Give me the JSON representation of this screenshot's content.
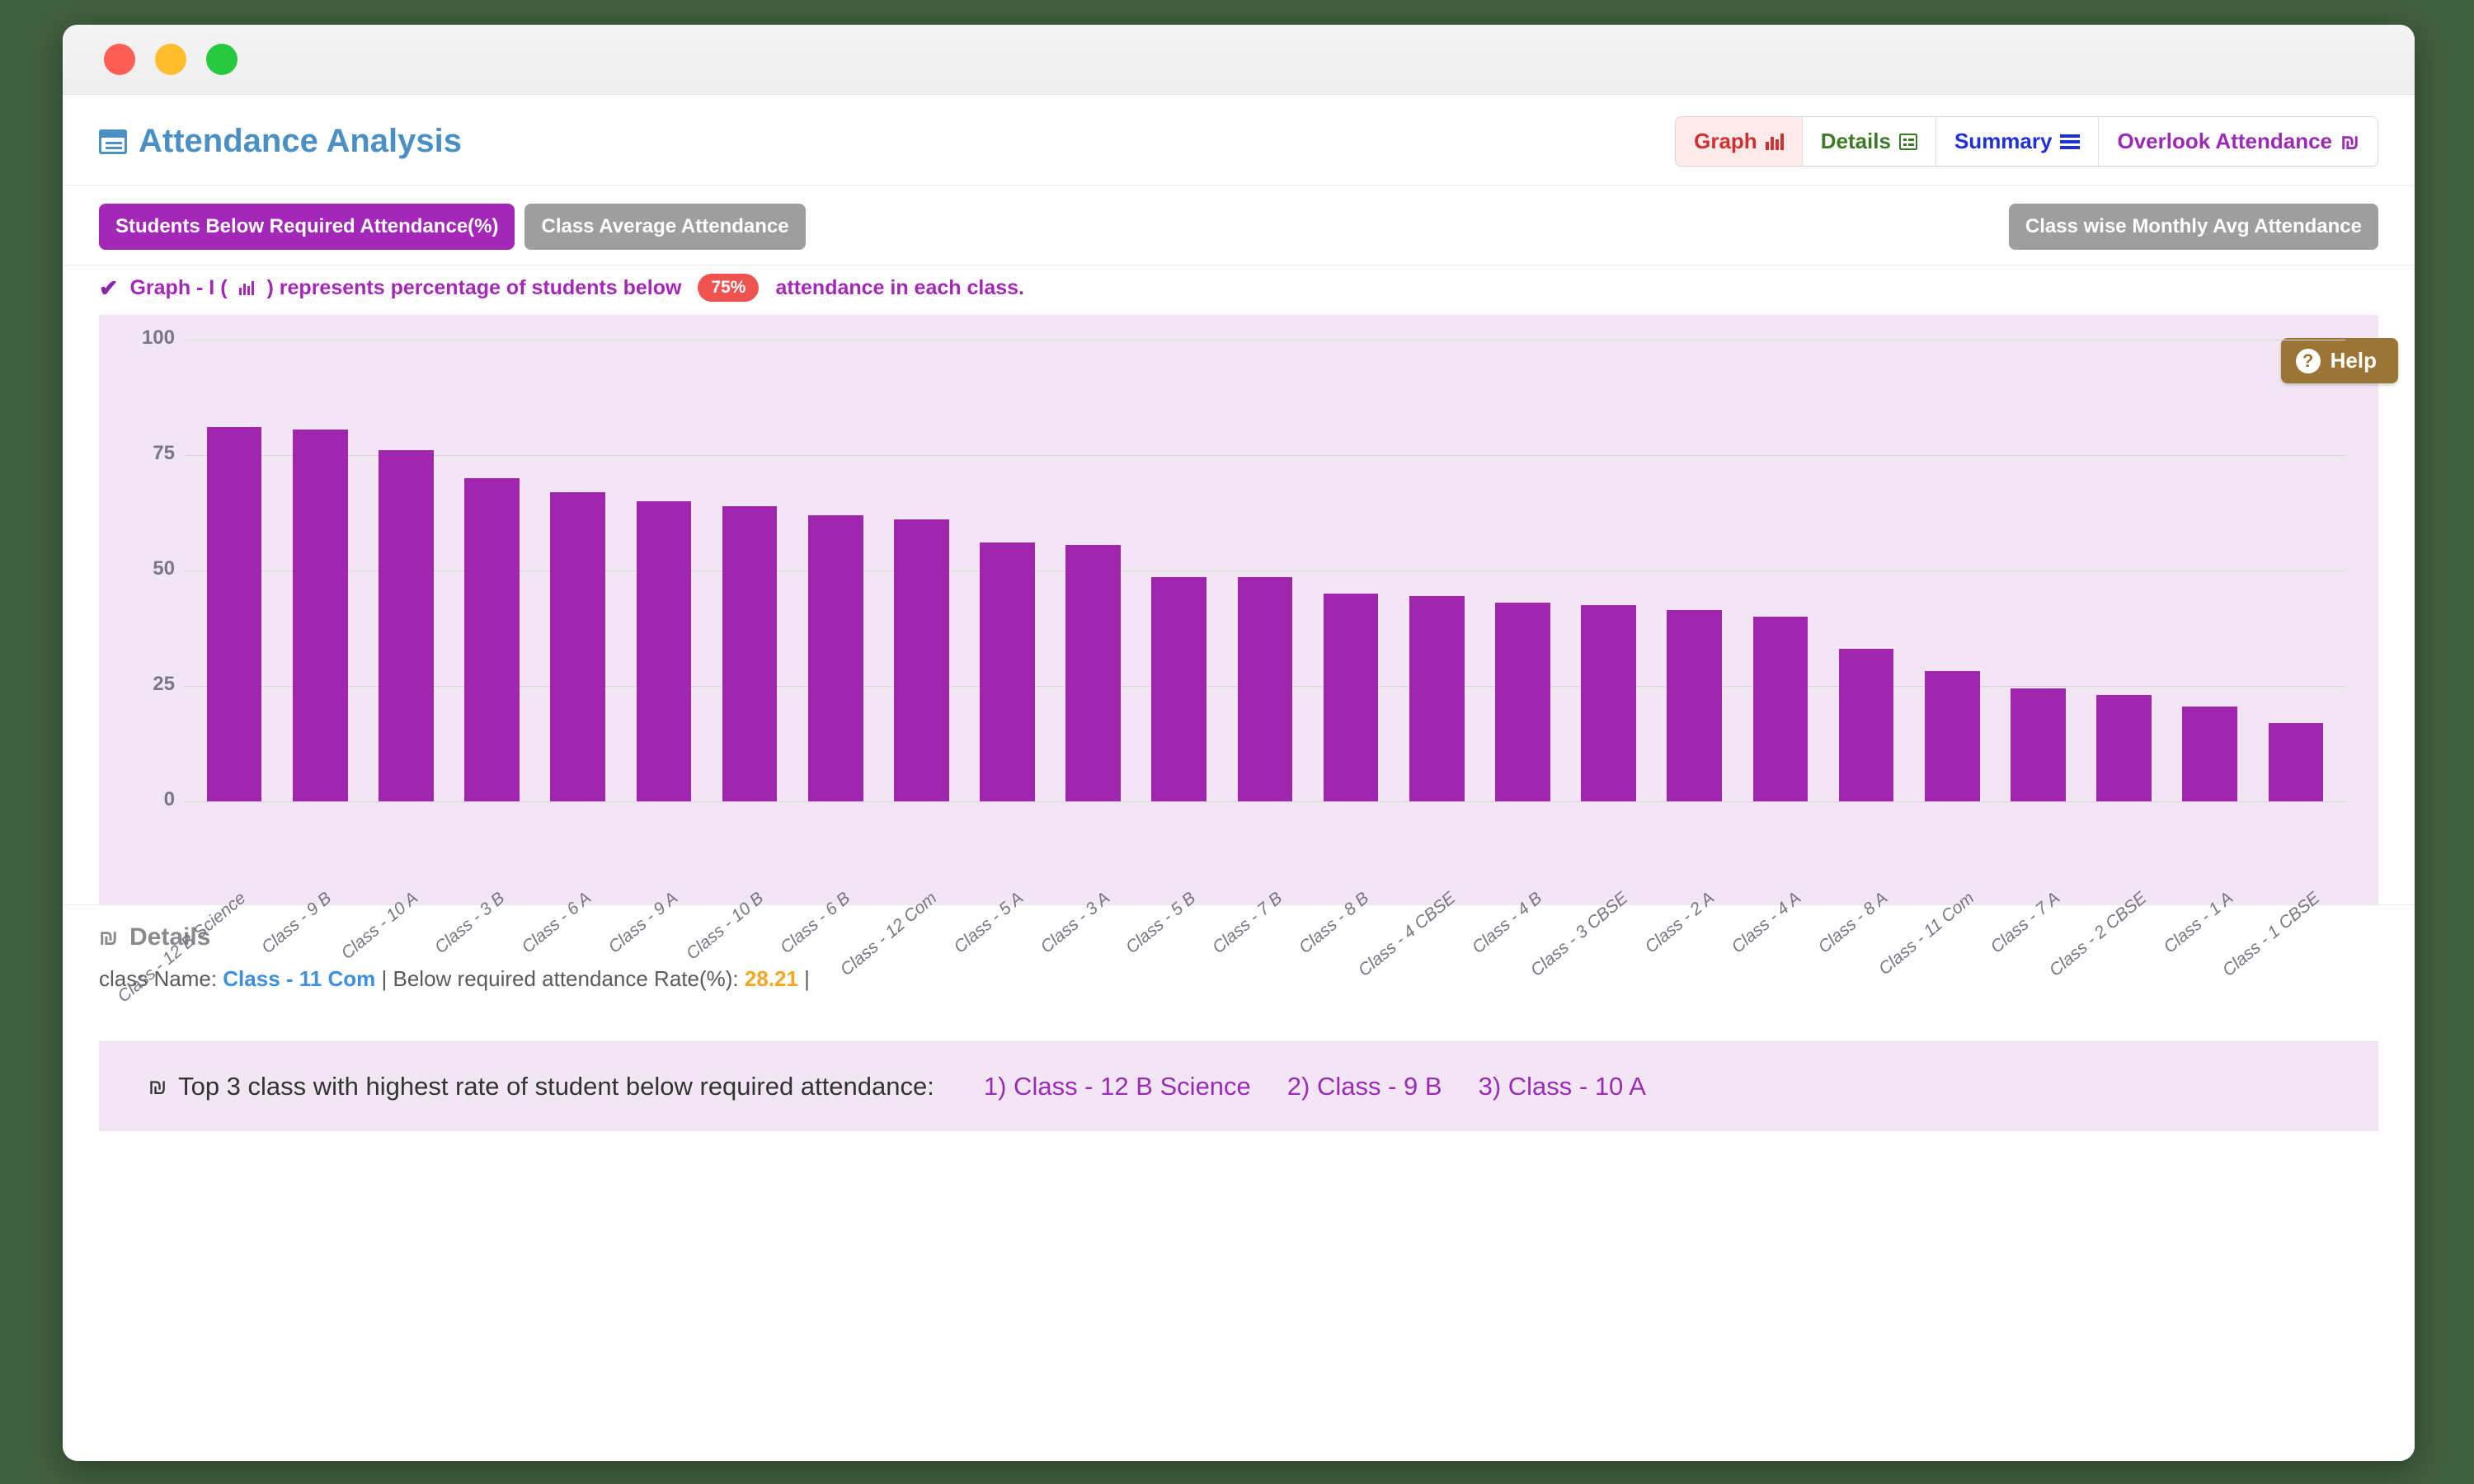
{
  "window": {
    "title": "Attendance Analysis"
  },
  "header": {
    "title": "Attendance Analysis",
    "title_icon": "list-card-icon",
    "nav": [
      {
        "label": "Graph",
        "icon": "bar-chart-icon",
        "active": true
      },
      {
        "label": "Details",
        "icon": "table-grid-icon",
        "active": false
      },
      {
        "label": "Summary",
        "icon": "lines-icon",
        "active": false
      },
      {
        "label": "Overlook Attendance",
        "icon": "shekel-icon",
        "active": false
      }
    ]
  },
  "toolbar": {
    "tab_students_below": "Students Below Required Attendance(%)",
    "tab_class_average": "Class Average Attendance",
    "monthly_avg_button": "Class wise Monthly Avg Attendance"
  },
  "info": {
    "check": "✔",
    "prefix": "Graph - I (",
    "icon": "bar-chart-icon",
    "middle": ") represents percentage of students below",
    "badge": "75%",
    "suffix": "attendance in each class."
  },
  "help": {
    "label": "Help",
    "icon": "question-circle-icon"
  },
  "chart_data": {
    "type": "bar",
    "title": "",
    "xlabel": "",
    "ylabel": "",
    "ylim": [
      0,
      100
    ],
    "yticks": [
      100,
      75,
      50,
      25,
      0
    ],
    "grid": true,
    "legend": "none",
    "bar_color": "#a026b0",
    "plot_bg": "#f2e6f5",
    "categories": [
      "Class - 12 B Science",
      "Class - 9 B",
      "Class - 10 A",
      "Class - 3 B",
      "Class - 6 A",
      "Class - 9 A",
      "Class - 10 B",
      "Class - 6 B",
      "Class - 12 Com",
      "Class - 5 A",
      "Class - 3 A",
      "Class - 5 B",
      "Class - 7 B",
      "Class - 8 B",
      "Class - 4 CBSE",
      "Class - 4 B",
      "Class - 3 CBSE",
      "Class - 2 A",
      "Class - 4 A",
      "Class - 8 A",
      "Class - 11 Com",
      "Class - 7 A",
      "Class - 2 CBSE",
      "Class - 1 A",
      "Class - 1 CBSE"
    ],
    "values": [
      81,
      80.5,
      76,
      70,
      67,
      65,
      64,
      62,
      61,
      56,
      55.5,
      48.5,
      48.5,
      45,
      44.5,
      43,
      42.5,
      41.5,
      40,
      33,
      28.21,
      24.5,
      23,
      20.5,
      17
    ]
  },
  "details": {
    "heading": "Details",
    "heading_icon": "shekel-icon",
    "label_class": "class Name:",
    "class_name": "Class - 11 Com",
    "separator1": "|",
    "label_rate": "Below required attendance Rate(%):",
    "rate": "28.21",
    "separator2": "|"
  },
  "summary": {
    "icon": "shekel-icon",
    "label": "Top 3 class with highest rate of student below required attendance:",
    "top3": [
      "1) Class - 12 B Science",
      "2) Class - 9 B",
      "3) Class - 10 A"
    ]
  }
}
